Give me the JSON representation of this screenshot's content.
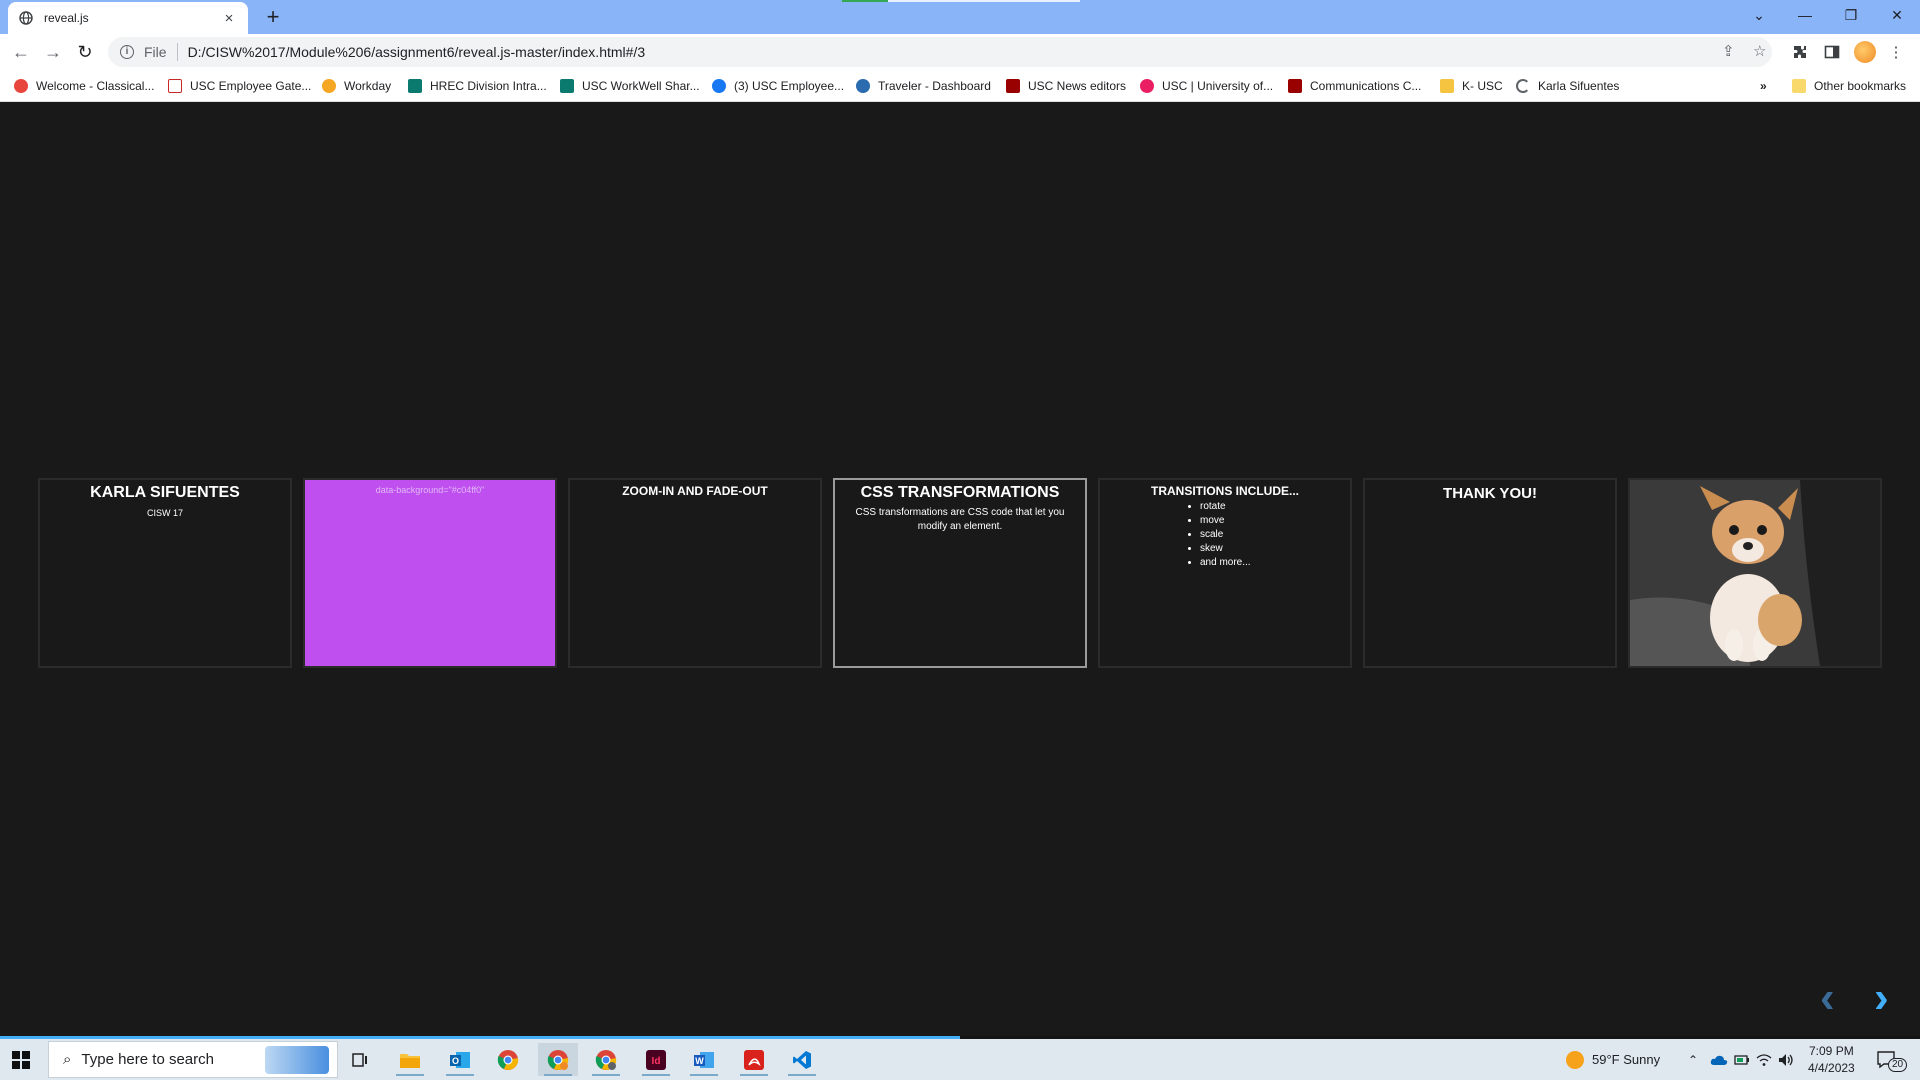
{
  "browser": {
    "tab_title": "reveal.js",
    "tab_close": "×",
    "new_tab": "+",
    "window_controls": {
      "tablist": "⌄",
      "minimize": "—",
      "restore": "❐",
      "close": "✕"
    },
    "address": {
      "scheme": "File",
      "url": "D:/CISW%2017/Module%206/assignment6/reveal.js-master/index.html#/3"
    },
    "nav": {
      "back": "←",
      "forward": "→",
      "reload": "↻"
    },
    "bookmarks": [
      {
        "label": "Welcome - Classical...",
        "color": "#e8453c"
      },
      {
        "label": "USC Employee Gate...",
        "color": "#c62828"
      },
      {
        "label": "Workday",
        "color": "#f5a623"
      },
      {
        "label": "HREC Division Intra...",
        "color": "#0b7a6e"
      },
      {
        "label": "USC WorkWell Shar...",
        "color": "#0b7a6e"
      },
      {
        "label": "(3) USC Employee...",
        "color": "#1877f2"
      },
      {
        "label": "Traveler - Dashboard",
        "color": "#2b6cb0"
      },
      {
        "label": "USC News editors",
        "color": "#990000"
      },
      {
        "label": "USC | University of...",
        "color": "#e91e63"
      },
      {
        "label": "Communications C...",
        "color": "#990000"
      },
      {
        "label": "K- USC",
        "color": "#f5c542"
      },
      {
        "label": "Karla Sifuentes",
        "color": "#5f6368"
      }
    ],
    "bookmarks_more": "»",
    "other_bookmarks": "Other bookmarks"
  },
  "slides": [
    {
      "title": "KARLA SIFUENTES",
      "subtitle": "CISW 17"
    },
    {
      "hint": "data-background=\"#c04ff0\"",
      "bg": "#c04ff0"
    },
    {
      "title": "ZOOM-IN AND FADE-OUT"
    },
    {
      "title": "CSS TRANSFORMATIONS",
      "body": "CSS transformations are CSS code that let you modify an element."
    },
    {
      "title": "TRANSITIONS INCLUDE...",
      "items": [
        "rotate",
        "move",
        "scale",
        "skew",
        "and more..."
      ]
    },
    {
      "title": "THANK YOU!"
    },
    {
      "image": "dog-photo"
    }
  ],
  "controls": {
    "prev": "‹",
    "next": "›",
    "accent": "#42affa"
  },
  "progress_fraction": 0.5,
  "taskbar": {
    "search_placeholder": "Type here to search",
    "weather": "59°F  Sunny",
    "time": "7:09 PM",
    "date": "4/4/2023",
    "notifications": "20"
  }
}
